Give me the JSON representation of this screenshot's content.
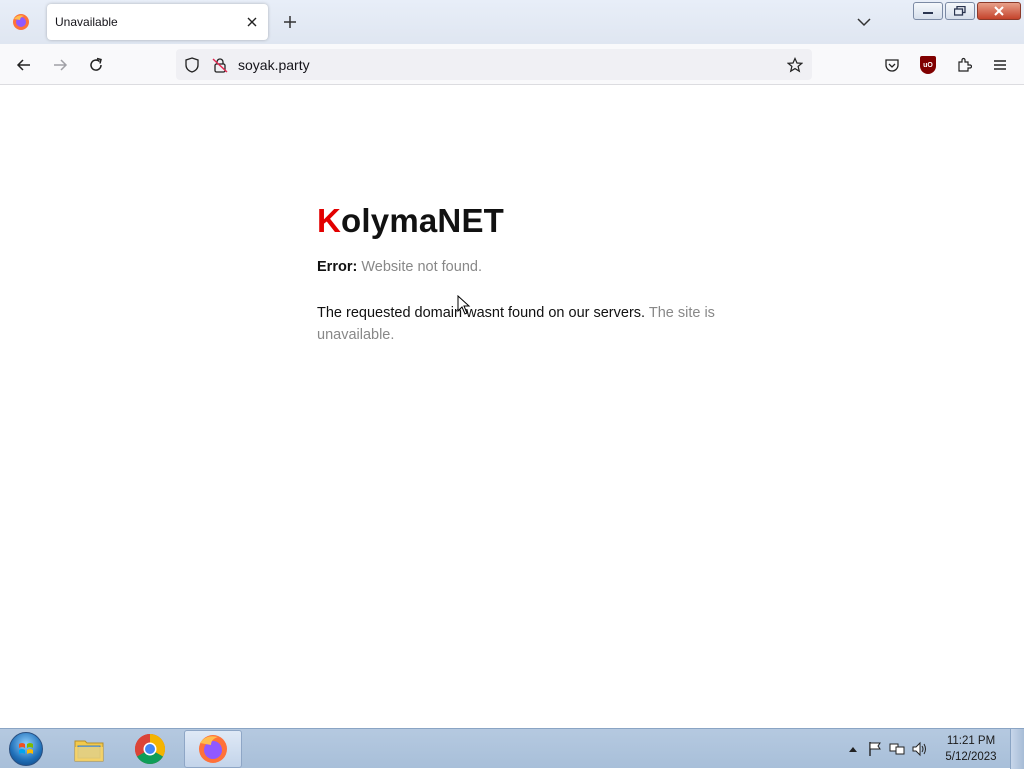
{
  "browser": {
    "tab_title": "Unavailable",
    "url": "soyak.party"
  },
  "page": {
    "brand_first": "K",
    "brand_rest": "olymaNET",
    "error_label": "Error:",
    "error_text": "Website not found.",
    "message_main": "The requested domain wasnt found on our servers.",
    "message_dim": "The site is unavailable."
  },
  "taskbar": {
    "time": "11:21 PM",
    "date": "5/12/2023"
  },
  "colors": {
    "brand_accent": "#e20000",
    "muted_text": "#888888"
  }
}
